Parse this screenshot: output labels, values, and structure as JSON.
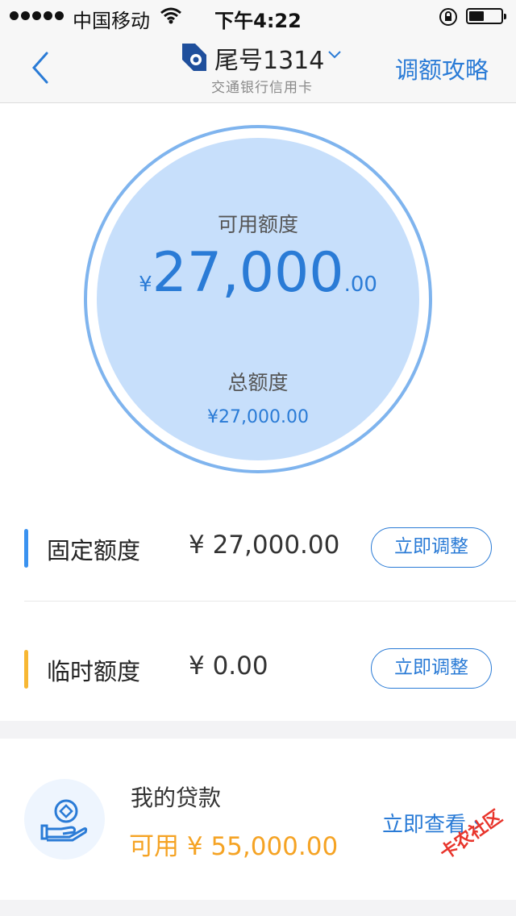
{
  "status_bar": {
    "carrier": "中国移动",
    "time": "下午4:22"
  },
  "nav": {
    "card_title": "尾号1314",
    "card_subtitle": "交通银行信用卡",
    "strategy_link": "调额攻略"
  },
  "summary": {
    "available_label": "可用额度",
    "currency_symbol": "¥",
    "available_amount": "27,000",
    "available_cents": ".00",
    "total_label": "总额度",
    "total_amount": "¥27,000.00"
  },
  "limits": [
    {
      "label": "固定额度",
      "value": "¥ 27,000.00",
      "button": "立即调整",
      "bar_color": "#3a92f0"
    },
    {
      "label": "临时额度",
      "value": "¥ 0.00",
      "button": "立即调整",
      "bar_color": "#f7b733"
    }
  ],
  "loan": {
    "title": "我的贷款",
    "available": "可用  ¥ 55,000.00",
    "link": "立即查看 ›"
  },
  "watermark": "卡农社区",
  "colors": {
    "accent": "#2a7bd6",
    "circle_fill": "#c7dffb",
    "loan_orange": "#f5a324"
  },
  "icons": [
    "back-icon",
    "bank-logo",
    "chevron-down-icon",
    "loan-hand-coin-icon"
  ]
}
